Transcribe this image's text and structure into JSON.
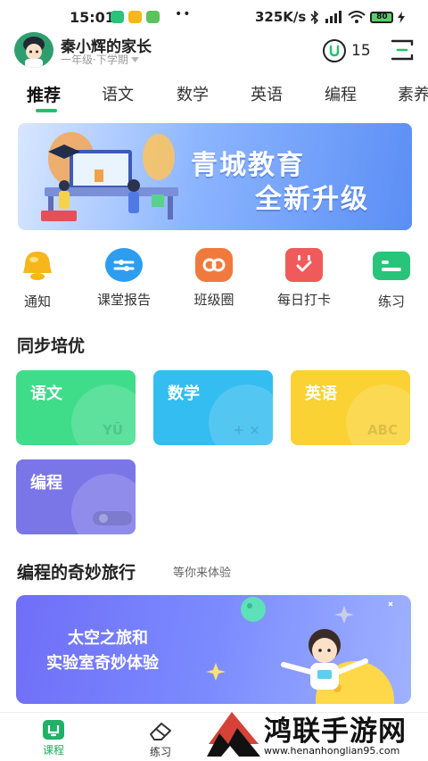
{
  "status_bar": {
    "time": "15:01",
    "network_speed": "325K/s",
    "battery": "80"
  },
  "header": {
    "parent_name": "秦小辉的家长",
    "grade": "一年级·下学期",
    "coin_count": "15"
  },
  "tabs": [
    {
      "label": "推荐",
      "active": true
    },
    {
      "label": "语文",
      "active": false
    },
    {
      "label": "数学",
      "active": false
    },
    {
      "label": "英语",
      "active": false
    },
    {
      "label": "编程",
      "active": false
    },
    {
      "label": "素养",
      "active": false
    }
  ],
  "banner": {
    "line1": "青城教育",
    "line2": "全新升级"
  },
  "quick_actions": [
    {
      "label": "通知",
      "icon": "bell-icon",
      "color": "#f7b61a"
    },
    {
      "label": "课堂报告",
      "icon": "report-icon",
      "color": "#2d9df0"
    },
    {
      "label": "班级圈",
      "icon": "class-circle-icon",
      "color": "#f07a3d"
    },
    {
      "label": "每日打卡",
      "icon": "calendar-check-icon",
      "color": "#f05a5a"
    },
    {
      "label": "练习",
      "icon": "practice-icon",
      "color": "#28c47a"
    }
  ],
  "sync_section": {
    "title": "同步培优",
    "subjects": [
      {
        "label": "语文",
        "deco": "YŪ",
        "color": "#3fdc8a"
      },
      {
        "label": "数学",
        "deco": "+ ×",
        "color": "#33bdf0"
      },
      {
        "label": "英语",
        "deco": "ABC",
        "color": "#fbd233"
      },
      {
        "label": "编程",
        "deco": "",
        "color": "#7a76e8"
      }
    ]
  },
  "coding_section": {
    "title": "编程的奇妙旅行",
    "subtitle": "等你来体验",
    "promo_line1": "太空之旅和",
    "promo_line2": "实验室奇妙体验"
  },
  "bottom_nav": [
    {
      "label": "课程",
      "icon": "course-icon",
      "active": true
    },
    {
      "label": "练习",
      "icon": "eraser-icon",
      "active": false
    }
  ],
  "watermark": {
    "title": "鸿联手游网",
    "url": "www.henanhonglian95.com"
  }
}
